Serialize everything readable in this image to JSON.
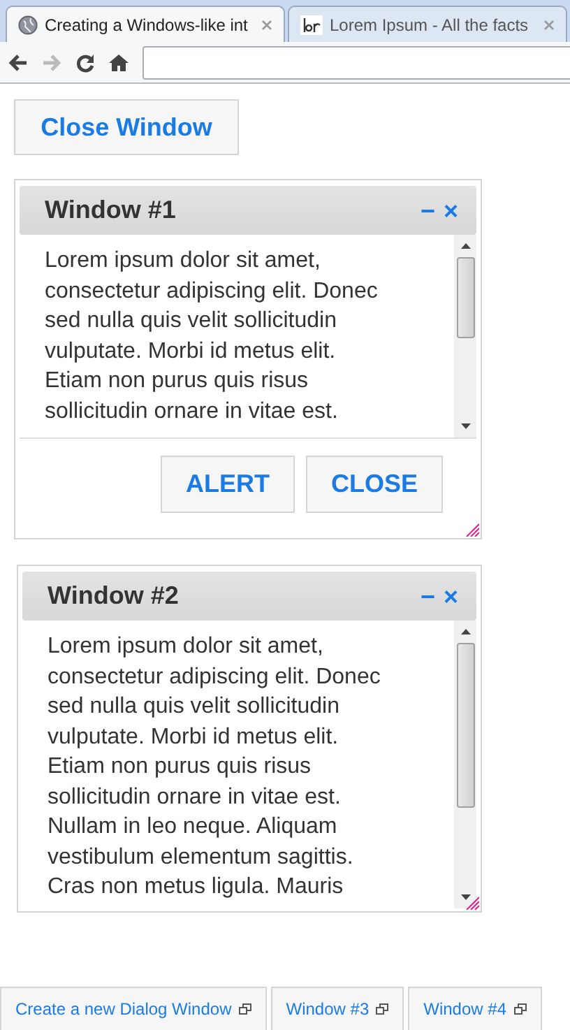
{
  "browser": {
    "tabs": [
      {
        "title": "Creating a Windows-like int",
        "selected": true,
        "kind": "globe"
      },
      {
        "title": "Lorem Ipsum - All the facts",
        "selected": false,
        "kind": "lorem"
      }
    ]
  },
  "close_window_button": "Close Window",
  "windows": [
    {
      "title": "Window #1",
      "minimize": "−",
      "close": "×",
      "text": "Lorem ipsum dolor sit amet, consectetur adipiscing elit. Donec sed nulla quis velit sollicitudin vulputate. Morbi id metus elit. Etiam non purus quis risus sollicitudin ornare in vitae est.",
      "buttons": [
        "ALERT",
        "CLOSE"
      ]
    },
    {
      "title": "Window #2",
      "minimize": "−",
      "close": "×",
      "text": "Lorem ipsum dolor sit amet, consectetur adipiscing elit. Donec sed nulla quis velit sollicitudin vulputate. Morbi id metus elit. Etiam non purus quis risus sollicitudin ornare in vitae est. Nullam in leo neque. Aliquam vestibulum elementum sagittis. Cras non metus ligula. Mauris"
    }
  ],
  "taskbar": [
    "Create a new Dialog Window",
    "Window #3",
    "Window #4"
  ]
}
